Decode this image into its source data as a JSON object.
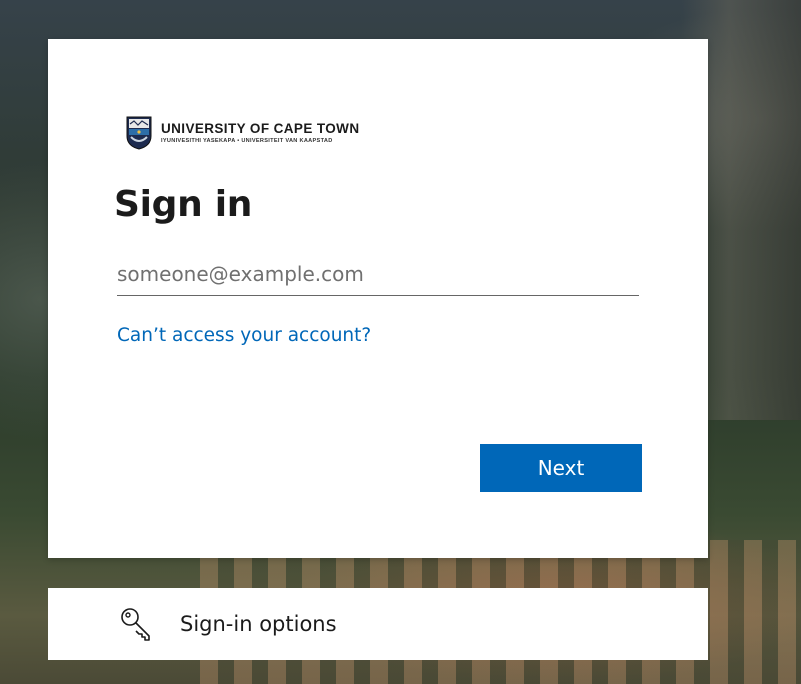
{
  "background": {
    "description_colors": [
      "#2e3a32",
      "#3a4a32"
    ]
  },
  "card": {
    "logo": {
      "name": "UNIVERSITY OF CAPE TOWN",
      "subtitle": "IYUNIVESITHI YASEKAPA • UNIVERSITEIT VAN KAAPSTAD",
      "icon": "crest-icon"
    },
    "title": "Sign in",
    "email": {
      "placeholder": "someone@example.com",
      "value": ""
    },
    "help_link": "Can’t access your account?",
    "next_button": "Next"
  },
  "options": {
    "label": "Sign-in options",
    "icon": "key-icon"
  },
  "colors": {
    "accent": "#0067b8",
    "link": "#0067b8",
    "text": "#1b1b1b"
  }
}
